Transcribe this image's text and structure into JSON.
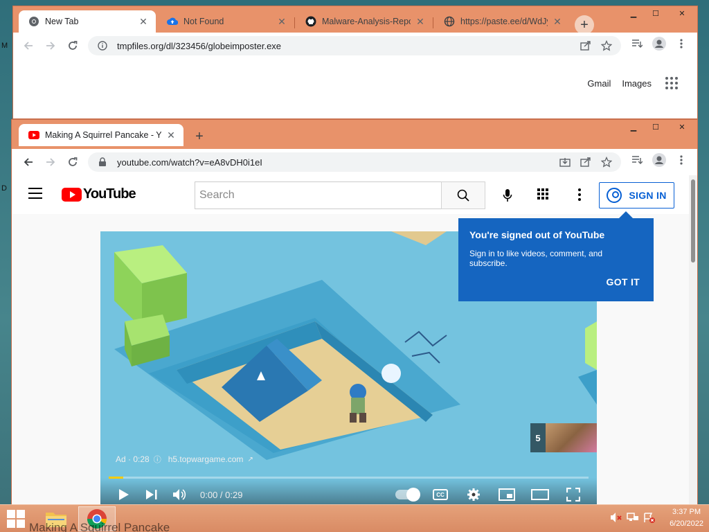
{
  "desktop": {
    "side_letters": [
      "M",
      "D"
    ]
  },
  "window1": {
    "tabs": [
      {
        "label": "New Tab",
        "icon": "chrome-icon"
      },
      {
        "label": "Not Found",
        "icon": "cloud-upload-icon"
      },
      {
        "label": "Malware-Analysis-Report",
        "icon": "github-icon"
      },
      {
        "label": "https://paste.ee/d/WdJyl",
        "icon": "globe-icon"
      }
    ],
    "url": "tmpfiles.org/dl/323456/globeimposter.exe",
    "links": {
      "gmail": "Gmail",
      "images": "Images"
    }
  },
  "window2": {
    "tab_title": "Making A Squirrel Pancake - You",
    "url": "youtube.com/watch?v=eA8vDH0i1eI",
    "youtube": {
      "logo_text": "YouTube",
      "search_placeholder": "Search",
      "sign_in": "SIGN IN",
      "tooltip": {
        "title": "You're signed out of YouTube",
        "body": "Sign in to like videos, comment, and subscribe.",
        "button": "GOT IT"
      },
      "player": {
        "ad_label": "Ad · 0:28",
        "ad_domain": "h5.topwargame.com",
        "skip_count": "5",
        "time": "0:00 / 0:29",
        "progress": 0.03
      }
    }
  },
  "taskbar": {
    "time": "3:37 PM",
    "date": "6/20/2022",
    "ghost_title": "Making A Squirrel Pancake"
  },
  "colors": {
    "window_frame": "#e8926a",
    "youtube_red": "#ff0000",
    "tooltip_blue": "#1565c0",
    "signin_blue": "#065fd4",
    "ad_progress": "#ffcc00"
  }
}
